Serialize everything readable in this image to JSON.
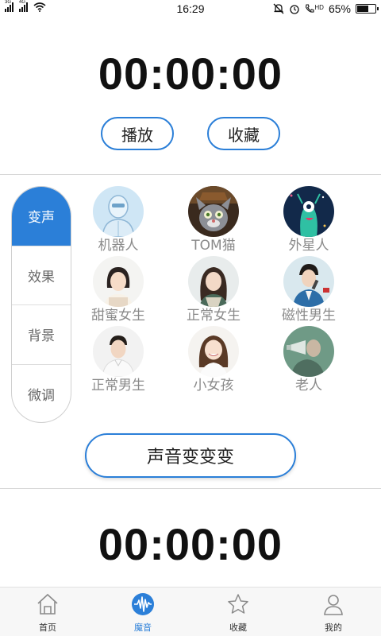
{
  "status_bar": {
    "sim1_label": "3G",
    "sim2_label": "4G",
    "time": "16:29",
    "hd_label": "HD",
    "battery_text": "65%",
    "battery_level": 0.65
  },
  "top_timer": "00:00:00",
  "buttons": {
    "play": "播放",
    "favorite": "收藏",
    "transform": "声音变变变"
  },
  "side_tabs": [
    {
      "label": "变声",
      "active": true
    },
    {
      "label": "效果",
      "active": false
    },
    {
      "label": "背景",
      "active": false
    },
    {
      "label": "微调",
      "active": false
    }
  ],
  "voices": [
    {
      "label": "机器人",
      "icon": "robot-avatar"
    },
    {
      "label": "TOM猫",
      "icon": "tom-cat-avatar"
    },
    {
      "label": "外星人",
      "icon": "alien-avatar"
    },
    {
      "label": "甜蜜女生",
      "icon": "sweet-girl-avatar"
    },
    {
      "label": "正常女生",
      "icon": "normal-girl-avatar"
    },
    {
      "label": "磁性男生",
      "icon": "magnetic-boy-avatar"
    },
    {
      "label": "正常男生",
      "icon": "normal-boy-avatar"
    },
    {
      "label": "小女孩",
      "icon": "little-girl-avatar"
    },
    {
      "label": "老人",
      "icon": "old-man-avatar"
    }
  ],
  "bottom_timer": "00:00:00",
  "bottom_nav": [
    {
      "label": "首页",
      "icon": "home-icon",
      "active": false
    },
    {
      "label": "魔音",
      "icon": "sound-wave-icon",
      "active": true
    },
    {
      "label": "收藏",
      "icon": "star-icon",
      "active": false
    },
    {
      "label": "我的",
      "icon": "user-icon",
      "active": false
    }
  ],
  "colors": {
    "accent": "#2b7fd8",
    "label_gray": "#8a8a8a"
  }
}
